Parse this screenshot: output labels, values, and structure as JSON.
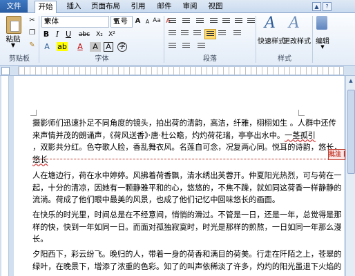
{
  "ribbon_tabs": {
    "file": "文件",
    "home": "开始",
    "insert": "插入",
    "layout": "页面布局",
    "references": "引用",
    "mailings": "邮件",
    "review": "审阅",
    "view": "视图"
  },
  "clipboard": {
    "paste_label": "粘贴",
    "group_label": "剪贴板"
  },
  "font": {
    "name": "宋体",
    "size": "五号",
    "group_label": "字体",
    "grow": "A",
    "shrink": "A",
    "aa": "Aa",
    "clear": "A",
    "wen": "wén",
    "bold": "B",
    "italic": "I",
    "underline": "U",
    "strike": "abc",
    "subscript": "X₂",
    "superscript": "X²",
    "font_color": "A",
    "char_shade": "A",
    "char_border": "A",
    "circle": "字"
  },
  "paragraph": {
    "group_label": "段落"
  },
  "styles": {
    "quick_label": "快速样式",
    "change_label": "更改样式",
    "group_label": "样式",
    "big_a": "A"
  },
  "editing": {
    "label": "编辑"
  },
  "document": {
    "p1": [
      "摄影师们迅速扑足不同角度的镜头，拍出荷的清韵，高洁，纤雅，栩栩如生 。人群中还传",
      "来声情并茂的朗诵声，《荷风送香》·唐·杜公瞻，灼灼荷花瑞，亭亭出水中。",
      "，双影共分红。色夺歌人脸，香乱舞衣风。名莲自可念，况复两心同。悦耳的诗韵，悠长，",
      "悠长"
    ],
    "p1_underlined": [
      "一茎孤引",
      "况复两心同"
    ],
    "p2": [
      "人在塘边行，荷在水中婷婷。风拂着荷香飘，清水绣出芙蓉开。仲夏阳光热烈，可与荷在一",
      "起，十分的清凉，因她有一颗静雅平和的心，悠悠的，不焦不躁，就如同这荷香一样静静的",
      "流淌。荷成了他们眼中最美的风景，也成了他们记忆中回味悠长的画面。"
    ],
    "p3": [
      "在快乐的时光里，时间总是在不经意间，悄悄的滑过。不管是一日，还是一年，总觉得是那",
      "样的快，快到一年如同一日。而面对孤独寂寞时，时光是那样的煎熬，一日如同一年那么漫",
      "长。"
    ],
    "p4": [
      "夕阳西下，彩云纷飞。晚归的人，带着一身的荷香和满目的荷美。行走在阡陌之上，苍翠的",
      "绿叶，在晚景下，增添了浓重的色彩。知了的叫声依稀淡了许多，灼灼的阳光虽退下火焰的"
    ],
    "comment_label": "批注 [微软"
  }
}
